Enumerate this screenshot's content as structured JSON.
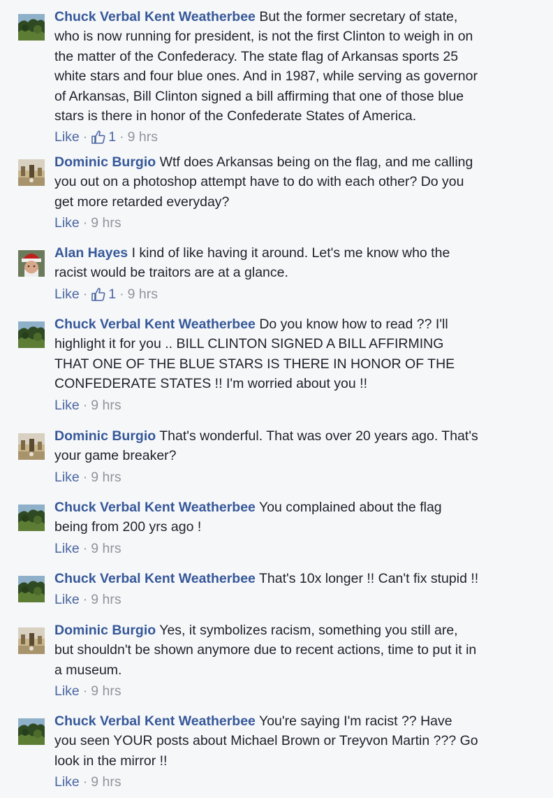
{
  "comments": [
    {
      "author": "Chuck Verbal Kent Weatherbee",
      "text": "But the former secretary of state,\nwho is now running for president, is not the first Clinton to weigh in on\nthe matter of the Confederacy. The state flag of Arkansas sports 25\nwhite stars and four blue ones. And in 1987, while serving as governor\nof Arkansas, Bill Clinton signed a bill affirming that one of those blue\nstars is there in honor of the Confederate States of America.",
      "like_label": "Like",
      "likes": "1",
      "time": "9 hrs",
      "avatar_icon": "landscape-avatar-icon"
    },
    {
      "author": "Dominic Burgio",
      "text": "Wtf does Arkansas being on the flag, and me calling\nyou out on a photoshop attempt have to do with each other? Do you\nget more retarded everyday?",
      "like_label": "Like",
      "likes": "",
      "time": "9 hrs",
      "avatar_icon": "event-photo-avatar-icon"
    },
    {
      "author": "Alan Hayes",
      "text": "I kind of like having it around. Let's me know who the\nracist would be traitors are at a glance.",
      "like_label": "Like",
      "likes": "1",
      "time": "9 hrs",
      "avatar_icon": "santa-hat-avatar-icon"
    },
    {
      "author": "Chuck Verbal Kent Weatherbee",
      "text": "Do you know how to read ?? I'll\nhighlight it for you .. BILL CLINTON SIGNED A BILL AFFIRMING\nTHAT ONE OF THE BLUE STARS IS THERE IN HONOR OF THE\nCONFEDERATE STATES !! I'm worried about you !!",
      "like_label": "Like",
      "likes": "",
      "time": "9 hrs",
      "avatar_icon": "landscape-avatar-icon"
    },
    {
      "author": "Dominic Burgio",
      "text": "That's wonderful. That was over 20 years ago. That's\nyour game breaker?",
      "like_label": "Like",
      "likes": "",
      "time": "9 hrs",
      "avatar_icon": "event-photo-avatar-icon"
    },
    {
      "author": "Chuck Verbal Kent Weatherbee",
      "text": "You complained about the flag\nbeing from 200 yrs ago !",
      "like_label": "Like",
      "likes": "",
      "time": "9 hrs",
      "avatar_icon": "landscape-avatar-icon"
    },
    {
      "author": "Chuck Verbal Kent Weatherbee",
      "text": "That's 10x longer !! Can't fix stupid !!",
      "like_label": "Like",
      "likes": "",
      "time": "9 hrs",
      "avatar_icon": "landscape-avatar-icon"
    },
    {
      "author": "Dominic Burgio",
      "text": "Yes, it symbolizes racism, something you still are,\nbut shouldn't be shown anymore due to recent actions, time to put it in\na museum.",
      "like_label": "Like",
      "likes": "",
      "time": "9 hrs",
      "avatar_icon": "event-photo-avatar-icon"
    },
    {
      "author": "Chuck Verbal Kent Weatherbee",
      "text": "You're saying I'm racist ?? Have\nyou seen YOUR posts about Michael Brown or Treyvon Martin ??? Go\nlook in the mirror !!",
      "like_label": "Like",
      "likes": "",
      "time": "9 hrs",
      "avatar_icon": "landscape-avatar-icon"
    }
  ],
  "colors": {
    "author": "#365899",
    "link": "#4b67a1",
    "meta": "#90949c",
    "text": "#1d2129",
    "background": "#f6f7f9"
  }
}
